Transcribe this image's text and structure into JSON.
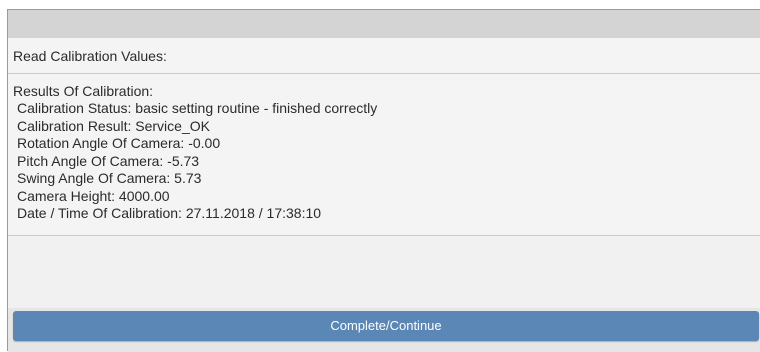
{
  "section": {
    "header": "Read Calibration Values:"
  },
  "results": {
    "heading": "Results Of Calibration:",
    "lines": [
      "Calibration Status: basic setting routine - finished correctly",
      "Calibration Result: Service_OK",
      "Rotation Angle Of Camera: -0.00",
      "Pitch Angle Of Camera: -5.73",
      "Swing Angle Of Camera: 5.73",
      "Camera Height: 4000.00",
      "Date / Time Of Calibration: 27.11.2018 / 17:38:10"
    ]
  },
  "footer": {
    "button_label": "Complete/Continue"
  },
  "colors": {
    "button": "#5a87b5",
    "title_bar": "#d4d4d4",
    "panel": "#f1f1f1"
  }
}
